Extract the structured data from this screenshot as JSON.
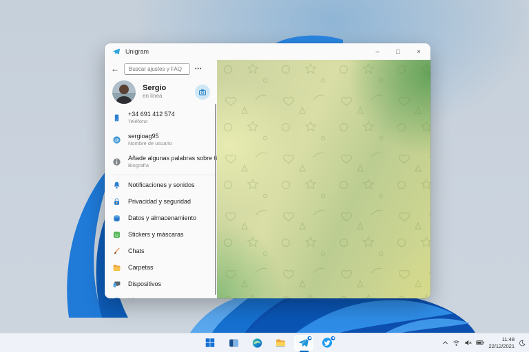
{
  "window": {
    "title": "Unigram",
    "controls": {
      "minimize": "–",
      "maximize": "□",
      "close": "×"
    },
    "search": {
      "placeholder": "Buscar ajustes y FAQ",
      "more_label": "•••",
      "back_label": "←"
    },
    "profile": {
      "name": "Sergio",
      "status": "en línea"
    },
    "fields": [
      {
        "icon": "phone-icon",
        "value": "+34 691 412 574",
        "label": "Teléfono"
      },
      {
        "icon": "at-icon",
        "value": "sergioag95",
        "label": "Nombre de usuario"
      },
      {
        "icon": "info-icon",
        "value": "Añade algunas palabras sobre ti",
        "label": "Biografía"
      }
    ],
    "menu": [
      {
        "icon": "bell-icon",
        "label": "Notificaciones y sonidos"
      },
      {
        "icon": "lock-icon",
        "label": "Privacidad y seguridad"
      },
      {
        "icon": "database-icon",
        "label": "Datos y almacenamiento"
      },
      {
        "icon": "sticker-icon",
        "label": "Stickers y máscaras"
      },
      {
        "icon": "brush-icon",
        "label": "Chats"
      },
      {
        "icon": "folder-icon",
        "label": "Carpetas"
      },
      {
        "icon": "devices-icon",
        "label": "Dispositivos"
      },
      {
        "icon": "globe-icon",
        "label": "Idioma"
      }
    ]
  },
  "taskbar": {
    "apps": [
      {
        "icon": "start-icon",
        "active": false,
        "badge": false
      },
      {
        "icon": "task-view-icon",
        "active": false,
        "badge": false
      },
      {
        "icon": "edge-icon",
        "active": false,
        "badge": false
      },
      {
        "icon": "file-explorer-icon",
        "active": false,
        "badge": false
      },
      {
        "icon": "unigram-icon",
        "active": true,
        "badge": true
      },
      {
        "icon": "twitter-icon",
        "active": false,
        "badge": true
      }
    ],
    "tray": {
      "icons": [
        "chevron-up-icon",
        "wifi-icon",
        "volume-muted-icon",
        "battery-icon",
        "moon-icon"
      ],
      "time": "11:48",
      "date": "22/12/2021"
    }
  },
  "colors": {
    "accent": "#0067c0",
    "telegram_blue": "#2ea4dd",
    "panel_bg": "#fafafa",
    "taskbar_bg": "#f0f3f9",
    "desktop_base": "#cbd4de",
    "desktop_glow": "#8cb4d6",
    "chat_green_dark": "#7fb477",
    "chat_green_light": "#e0e4ad",
    "chat_yellow": "#d5da90"
  }
}
